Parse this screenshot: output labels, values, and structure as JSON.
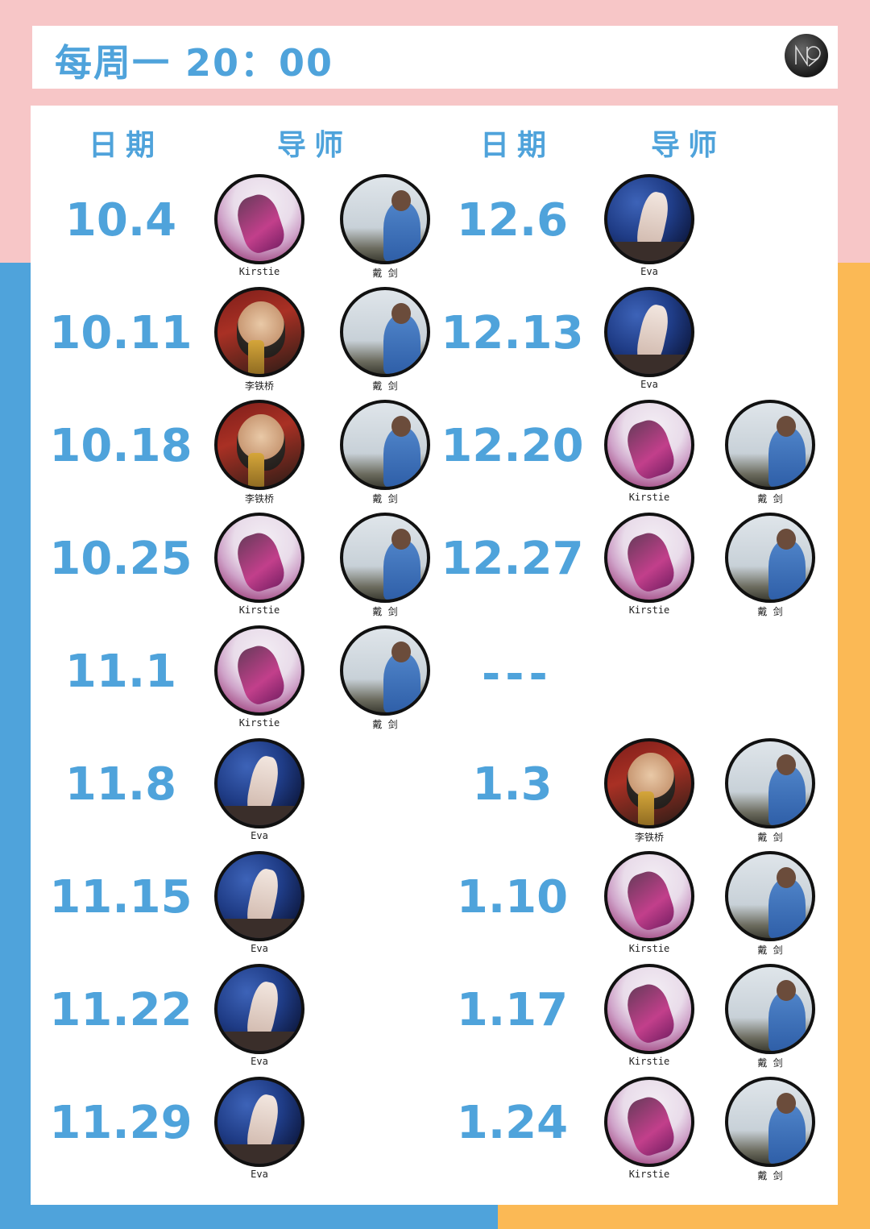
{
  "header": {
    "title": "每周一  20：00",
    "logo_icon": "nz-logo-icon"
  },
  "columns": {
    "date": "日期",
    "mentor": "导师"
  },
  "colors": {
    "accent": "#4fa3db",
    "pink": "#f7c6c7",
    "orange": "#fbb955"
  },
  "names": {
    "kirstie": "Kirstie",
    "dai": "戴 剑",
    "li": "李铁桥",
    "eva": "Eva"
  },
  "left_schedule": [
    {
      "date": "10.4",
      "mentors": [
        "Kirstie",
        "戴 剑"
      ]
    },
    {
      "date": "10.11",
      "mentors": [
        "李铁桥",
        "戴 剑"
      ]
    },
    {
      "date": "10.18",
      "mentors": [
        "李铁桥",
        "戴 剑"
      ]
    },
    {
      "date": "10.25",
      "mentors": [
        "Kirstie",
        "戴 剑"
      ]
    },
    {
      "date": "11.1",
      "mentors": [
        "Kirstie",
        "戴 剑"
      ]
    },
    {
      "date": "11.8",
      "mentors": [
        "Eva"
      ]
    },
    {
      "date": "11.15",
      "mentors": [
        "Eva"
      ]
    },
    {
      "date": "11.22",
      "mentors": [
        "Eva"
      ]
    },
    {
      "date": "11.29",
      "mentors": [
        "Eva"
      ]
    }
  ],
  "right_schedule": [
    {
      "date": "12.6",
      "mentors": [
        "Eva"
      ]
    },
    {
      "date": "12.13",
      "mentors": [
        "Eva"
      ]
    },
    {
      "date": "12.20",
      "mentors": [
        "Kirstie",
        "戴 剑"
      ]
    },
    {
      "date": "12.27",
      "mentors": [
        "Kirstie",
        "戴 剑"
      ]
    },
    {
      "date": "---",
      "mentors": []
    },
    {
      "date": "1.3",
      "mentors": [
        "李铁桥",
        "戴 剑"
      ]
    },
    {
      "date": "1.10",
      "mentors": [
        "Kirstie",
        "戴 剑"
      ]
    },
    {
      "date": "1.17",
      "mentors": [
        "Kirstie",
        "戴 剑"
      ]
    },
    {
      "date": "1.24",
      "mentors": [
        "Kirstie",
        "戴 剑"
      ]
    }
  ]
}
